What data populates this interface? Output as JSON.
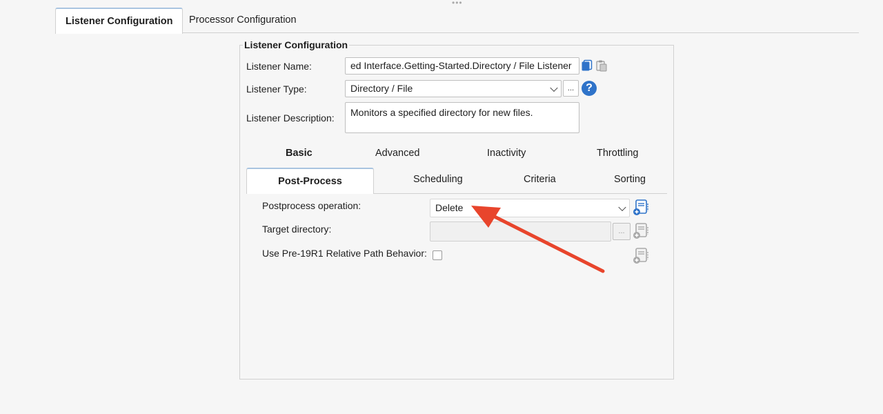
{
  "top_tabs": [
    {
      "label": "Listener Configuration",
      "active": true
    },
    {
      "label": "Processor Configuration",
      "active": false
    }
  ],
  "group": {
    "title": "Listener Configuration"
  },
  "fields": {
    "name_label": "Listener Name:",
    "name_value": "ed Interface.Getting-Started.Directory / File Listener",
    "type_label": "Listener Type:",
    "type_value": "Directory / File",
    "type_more": "...",
    "help": "?",
    "desc_label": "Listener Description:",
    "desc_value": "Monitors a specified directory for new files."
  },
  "tabs_row1": [
    "Basic",
    "Advanced",
    "Inactivity",
    "Throttling"
  ],
  "tabs_row2": [
    "Post-Process",
    "Scheduling",
    "Criteria",
    "Sorting"
  ],
  "postprocess": {
    "operation_label": "Postprocess operation:",
    "operation_value": "Delete",
    "target_label": "Target directory:",
    "target_value": "",
    "target_more": "...",
    "pre19_label": "Use Pre-19R1 Relative Path Behavior:",
    "pre19_checked": false
  },
  "colors": {
    "accent_blue": "#2f73c9",
    "arrow_red": "#e8452c"
  }
}
